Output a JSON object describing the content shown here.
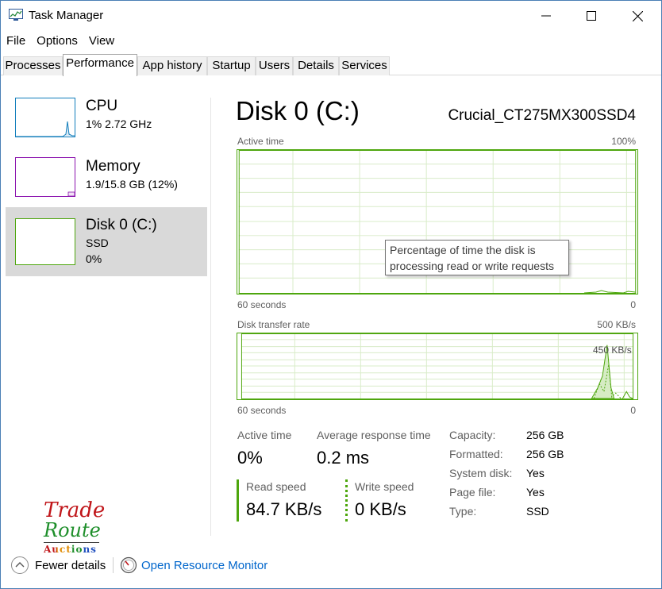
{
  "window": {
    "title": "Task Manager"
  },
  "menu": [
    "File",
    "Options",
    "View"
  ],
  "tabs": [
    "Processes",
    "Performance",
    "App history",
    "Startup",
    "Users",
    "Details",
    "Services"
  ],
  "sidebar": {
    "items": [
      {
        "name": "CPU",
        "sub1": "1%  2.72 GHz",
        "sub2": ""
      },
      {
        "name": "Memory",
        "sub1": "1.9/15.8 GB (12%)",
        "sub2": ""
      },
      {
        "name": "Disk 0 (C:)",
        "sub1": "SSD",
        "sub2": "0%"
      }
    ]
  },
  "disk": {
    "title": "Disk 0 (C:)",
    "model": "Crucial_CT275MX300SSD4",
    "active_graph": {
      "label": "Active time",
      "max": "100%",
      "time": "60 seconds",
      "min": "0"
    },
    "tooltip": "Percentage of time the disk is processing read or write requests",
    "transfer_graph": {
      "label": "Disk transfer rate",
      "max": "500 KB/s",
      "mid": "450 KB/s",
      "time": "60 seconds",
      "min": "0"
    },
    "stats": {
      "active_time_label": "Active time",
      "active_time_value": "0%",
      "avg_response_label": "Average response time",
      "avg_response_value": "0.2 ms",
      "read_label": "Read speed",
      "read_value": "84.7 KB/s",
      "write_label": "Write speed",
      "write_value": "0 KB/s"
    },
    "properties": [
      {
        "label": "Capacity:",
        "value": "256 GB"
      },
      {
        "label": "Formatted:",
        "value": "256 GB"
      },
      {
        "label": "System disk:",
        "value": "Yes"
      },
      {
        "label": "Page file:",
        "value": "Yes"
      },
      {
        "label": "Type:",
        "value": "SSD"
      }
    ]
  },
  "logo": {
    "line1": "Trade",
    "line2": "Route",
    "line3": "Auctions"
  },
  "footer": {
    "fewer_details": "Fewer details",
    "open_resource_monitor": "Open Resource Monitor"
  },
  "colors": {
    "disk_green": "#4da60c",
    "cpu_blue": "#117dbb",
    "memory_purple": "#8b12ae",
    "link_blue": "#0066cc"
  }
}
